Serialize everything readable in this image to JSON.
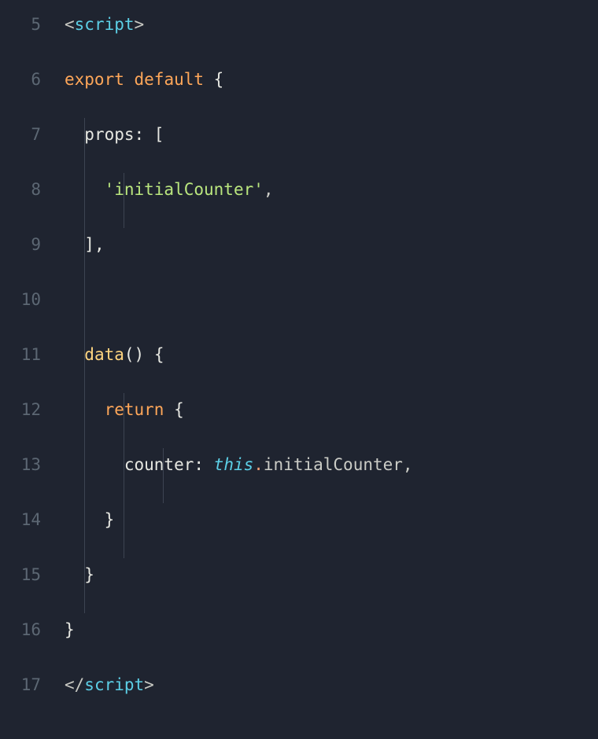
{
  "code_lines": [
    {
      "num": "5"
    },
    {
      "num": "6"
    },
    {
      "num": "7"
    },
    {
      "num": "8"
    },
    {
      "num": "9"
    },
    {
      "num": "10"
    },
    {
      "num": "11"
    },
    {
      "num": "12"
    },
    {
      "num": "13"
    },
    {
      "num": "14"
    },
    {
      "num": "15"
    },
    {
      "num": "16"
    },
    {
      "num": "17"
    }
  ],
  "tokens": {
    "l5_open": "<",
    "l5_tag": "script",
    "l5_close": ">",
    "l6_export": "export",
    "l6_default": "default",
    "l6_brace": " {",
    "l7_props": "props",
    "l7_colon_bracket": ": [",
    "l8_string": "'initialCounter'",
    "l8_comma": ",",
    "l9_close_bracket": "],",
    "l11_data": "data",
    "l11_parens": "()",
    "l11_brace": " {",
    "l12_return": "return",
    "l12_brace": " {",
    "l13_counter": "counter",
    "l13_colon": ": ",
    "l13_this": "this",
    "l13_dot": ".",
    "l13_member": "initialCounter",
    "l13_comma": ",",
    "l14_brace": "}",
    "l15_brace": "}",
    "l16_brace": "}",
    "l17_open": "</",
    "l17_tag": "script",
    "l17_close": ">"
  }
}
